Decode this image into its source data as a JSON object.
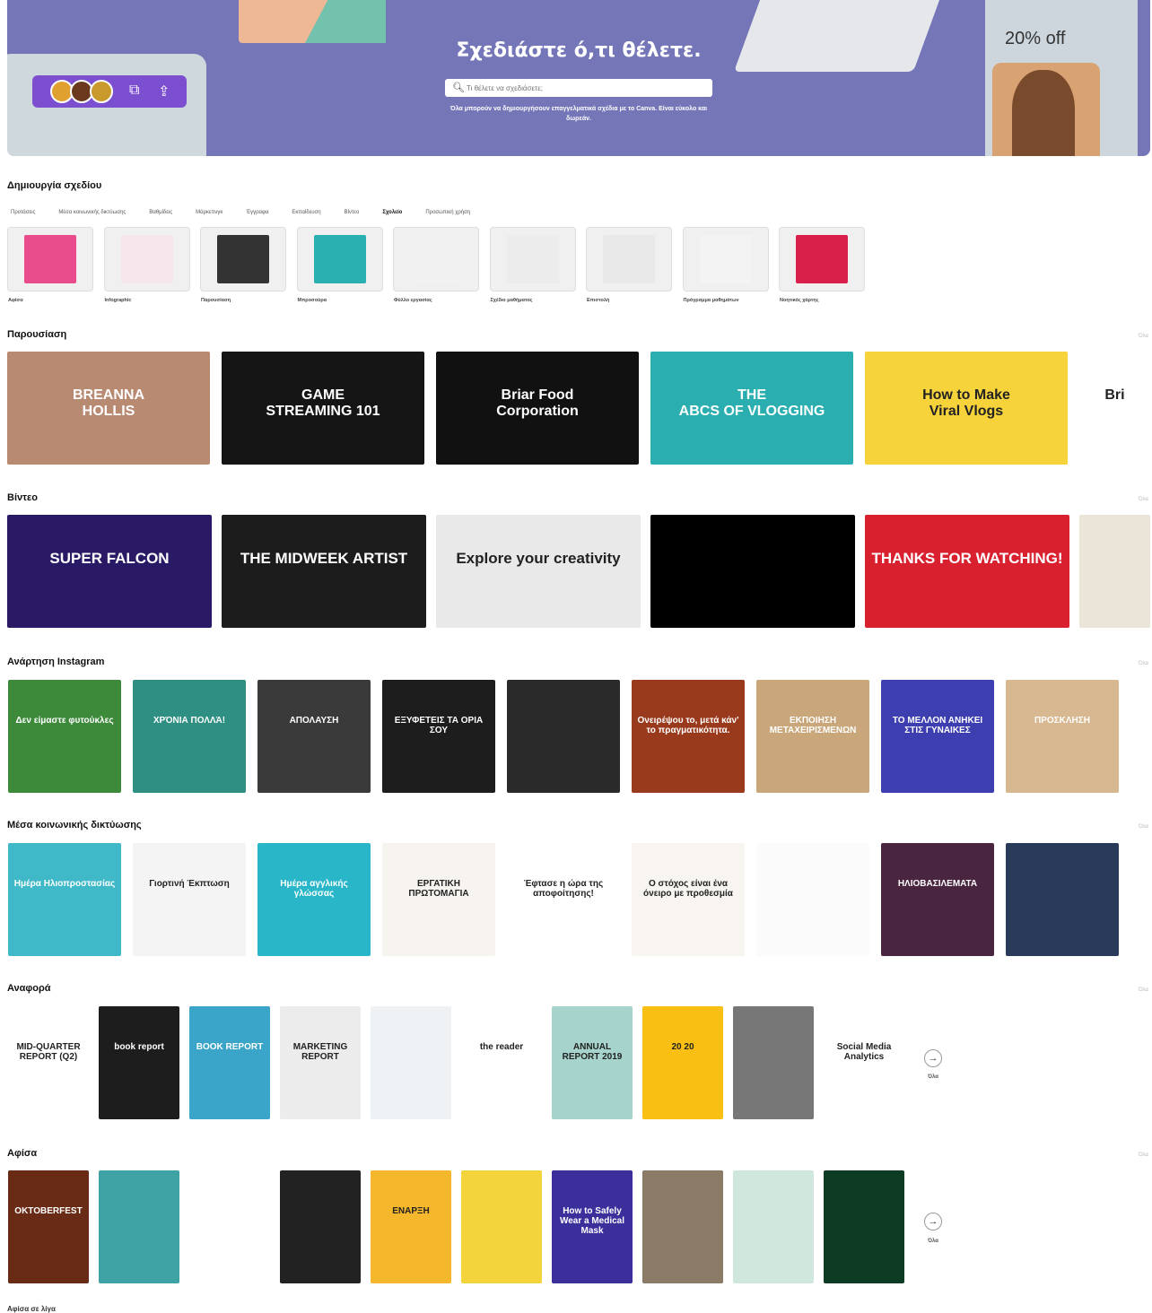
{
  "hero": {
    "title": "Σχεδιάστε ό,τι θέλετε.",
    "search_placeholder": "Τι θέλετε να σχεδιάσετε;",
    "subtitle": "Όλα μπορούν να δημιουργήσουν επαγγελματικά σχέδια με το Canva. Είναι εύκολο και δωρεάν.",
    "discount": "20% off"
  },
  "create": {
    "title": "Δημιουργία σχεδίου",
    "tabs": [
      "Προτάσεις",
      "Μέσα κοινωνικής δικτύωσης",
      "Βαθμίδεις",
      "Μάρκετινγκ",
      "Έγγραφα",
      "Εκπαίδευση",
      "Βίντεο",
      "Σχολείο",
      "Προσωπική χρήση"
    ],
    "active_tab": "Σχολείο",
    "items": [
      "Αφίσα",
      "Infographic",
      "Παρουσίαση",
      "Μπροσούρα",
      "Φύλλο εργασίας",
      "Σχέδιο μαθήματος",
      "Επιστολή",
      "Πρόγραμμα μαθημάτων",
      "Νοητικός χάρτης"
    ]
  },
  "sections": {
    "presentation": {
      "title": "Παρουσίαση",
      "see_all": "Όλα"
    },
    "video": {
      "title": "Βίντεο",
      "see_all": "Όλα"
    },
    "instagram": {
      "title": "Ανάρτηση Instagram",
      "see_all": "Όλα"
    },
    "social": {
      "title": "Μέσα κοινωνικής δικτύωσης",
      "see_all": "Όλα"
    },
    "report": {
      "title": "Αναφορά",
      "see_all": "Όλα",
      "more": "Όλα"
    },
    "poster": {
      "title": "Αφίσα",
      "see_all": "Όλα",
      "more": "Όλα"
    }
  },
  "presentation_cards": [
    {
      "line1": "BREANNA",
      "line2": "HOLLIS",
      "bg": "#b98a72"
    },
    {
      "line1": "GAME",
      "line2": "STREAMING 101",
      "bg": "#151515"
    },
    {
      "line1": "Briar Food",
      "line2": "Corporation",
      "bg": "#111111"
    },
    {
      "line1": "THE",
      "line2": "ABCS OF VLOGGING",
      "bg": "#2aaeb0"
    },
    {
      "line1": "How to Make",
      "line2": "Viral Vlogs",
      "bg": "#f6d23b"
    },
    {
      "line1": "Bri",
      "line2": "",
      "bg": "#ffffff"
    }
  ],
  "video_cards": [
    {
      "text": "SUPER FALCON",
      "bg": "#2a1a66"
    },
    {
      "text": "THE MIDWEEK ARTIST",
      "bg": "#1c1c1c"
    },
    {
      "text": "Explore your creativity",
      "bg": "#e9e9e9"
    },
    {
      "text": "",
      "bg": "#000000"
    },
    {
      "text": "THANKS FOR WATCHING!",
      "bg": "#d9202f"
    },
    {
      "text": "",
      "bg": "#ebe4d8"
    }
  ],
  "instagram_cards": [
    {
      "text": "Δεν είμαστε φυτούκλες",
      "bg": "#3c8a3a"
    },
    {
      "text": "ΧΡΌΝΙΑ ΠΟΛΛΆ!",
      "bg": "#2e8f82"
    },
    {
      "text": "ΑΠΟΛΑΥΣΗ",
      "bg": "#3a3a3a"
    },
    {
      "text": "ΕΞΥΦΕΤΕΙΣ ΤΑ ΟΡΙΑ ΣΟΥ",
      "bg": "#1d1d1d"
    },
    {
      "text": "",
      "bg": "#2a2a2a"
    },
    {
      "text": "Ονειρέψου το, μετά κάν' το πραγματικότητα.",
      "bg": "#9a3a1c"
    },
    {
      "text": "ΕΚΠΟΙΗΣΗ ΜΕΤΑΧΕΙΡΙΣΜΕΝΩΝ",
      "bg": "#c9a77a"
    },
    {
      "text": "ΤΟ ΜΕΛΛΟΝ ΑΝΗΚΕΙ ΣΤΙΣ ΓΥΝΑΙΚΕΣ",
      "bg": "#3d3fb0"
    },
    {
      "text": "ΠΡΟΣΚΛΗΣΗ",
      "bg": "#d8b890"
    }
  ],
  "social_cards": [
    {
      "text": "Ημέρα Ηλιοπροστασίας",
      "bg": "#3fb9c8"
    },
    {
      "text": "Γιορτινή Έκπτωση",
      "bg": "#f4f4f4"
    },
    {
      "text": "Ημέρα αγγλικής γλώσσας",
      "bg": "#29b6c8"
    },
    {
      "text": "ΕΡΓΑΤΙΚΗ ΠΡΩΤΟΜΑΓΙΑ",
      "bg": "#f7f3ee"
    },
    {
      "text": "Έφτασε η ώρα της αποφοίτησης!",
      "bg": "#ffffff"
    },
    {
      "text": "Ο στόχος είναι ένα όνειρο με προθεσμία",
      "bg": "#f8f5f0"
    },
    {
      "text": "",
      "bg": "#fbfbfb"
    },
    {
      "text": "ΗΛΙΟΒΑΣΙΛΕΜΑΤΑ",
      "bg": "#4a2540"
    },
    {
      "text": "",
      "bg": "#2a3a5a"
    }
  ],
  "report_cards": [
    {
      "text": "MID-QUARTER REPORT (Q2)",
      "bg": "#ffffff"
    },
    {
      "text": "book report",
      "bg": "#1d1d1d"
    },
    {
      "text": "BOOK REPORT",
      "bg": "#3aa4c9"
    },
    {
      "text": "MARKETING REPORT",
      "bg": "#ececec"
    },
    {
      "text": "",
      "bg": "#eef2f4"
    },
    {
      "text": "the reader",
      "bg": "#ffffff"
    },
    {
      "text": "ANNUAL REPORT 2019",
      "bg": "#a6d3cb"
    },
    {
      "text": "20 20",
      "bg": "#f9c013"
    },
    {
      "text": "",
      "bg": "#777777"
    },
    {
      "text": "Social Media Analytics",
      "bg": "#ffffff"
    }
  ],
  "poster_cards": [
    {
      "text": "OKTOBERFEST",
      "bg": "#6a2b16"
    },
    {
      "text": "",
      "bg": "#3fa3a5"
    },
    {
      "text": "",
      "bg": "#ffffff"
    },
    {
      "text": "",
      "bg": "#222222"
    },
    {
      "text": "ΕΝΑΡΞΗ",
      "bg": "#f5b72c"
    },
    {
      "text": "",
      "bg": "#f4d43c"
    },
    {
      "text": "How to Safely Wear a Medical Mask",
      "bg": "#3b2f9c"
    },
    {
      "text": "",
      "bg": "#8a7a66"
    },
    {
      "text": "",
      "bg": "#cfe7dc"
    },
    {
      "text": "",
      "bg": "#0d3b24"
    }
  ],
  "footer_text": "Αφίσα σε λίγα"
}
